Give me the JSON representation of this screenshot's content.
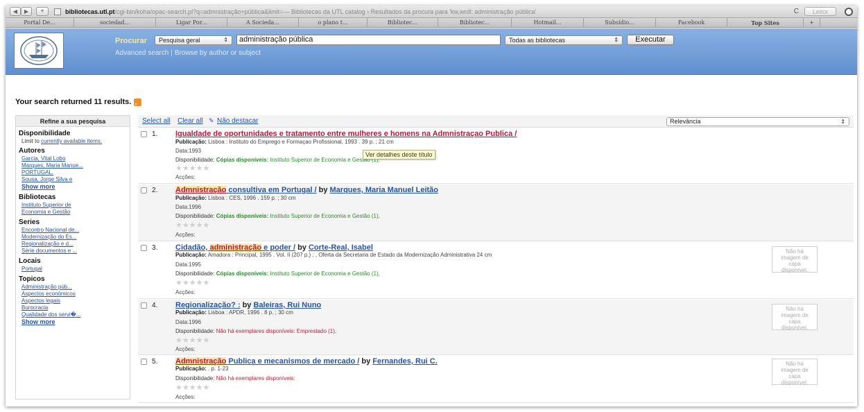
{
  "browser": {
    "url_host": "bibliotecas.utl.pt",
    "url_path": "/cgi-bin/koha/opac-search.pl?q=admnistração+pública&limit=",
    "page_title": " — Bibliotecas da UTL catalog › Resultados da procura para 'kw,wrdl: administração pública'",
    "reader_button": "Leitor",
    "bookmarks": [
      "Portal De...",
      "sociedad...",
      "Ligar Por...",
      "A Socieda...",
      "o plano t...",
      "Bibliotec...",
      "Bibliotec...",
      "Hotmail...",
      "Subsídio...",
      "Facebook",
      "Top Sites"
    ]
  },
  "header": {
    "search_label": "Procurar",
    "search_type": "Pesquisa geral",
    "search_value": "administração pública",
    "library_select": "Todas as bibliotecas",
    "execute_label": "Executar",
    "advanced_link": "Advanced search",
    "browse_link": "Browse by author or subject"
  },
  "results_summary": "Your search returned 11 results.",
  "sidebar": {
    "title": "Refine a sua pesquisa",
    "availability": {
      "heading": "Disponibilidade",
      "text_prefix": "Limit to ",
      "link": "currently available items."
    },
    "autores": {
      "heading": "Autores",
      "items": [
        "Garcia, Vital Lobo",
        "Marques, Maria Manue...",
        "PORTUGAL.",
        "Sousa, Jorge Silva e"
      ],
      "show_more": "Show more"
    },
    "bibliotecas": {
      "heading": "Bibliotecas",
      "items": [
        "Instituto Superior de",
        "Economia e Gestão"
      ]
    },
    "series": {
      "heading": "Series",
      "items": [
        "Encontro Nacional de...",
        "Modernização do Es...",
        "Regionalização e d...",
        "Série documentos e ..."
      ]
    },
    "locais": {
      "heading": "Locais",
      "items": [
        "Portugal"
      ]
    },
    "topicos": {
      "heading": "Topicos",
      "items": [
        "Administração púb...",
        "Aspectos económicos",
        "Aspectos legais",
        "Burocracia",
        "Qualidade dos servi�..."
      ],
      "show_more": "Show more"
    }
  },
  "toolbar": {
    "select_all": "Select all",
    "clear_all": "Clear all",
    "no_highlight": "Não destacar",
    "sort": "Relevância"
  },
  "tooltip": "Ver detalhes deste título",
  "results": [
    {
      "number": "1.",
      "title_main": "Igualdade de oportunidades e tratamento entre mulheres e homens na Admnistraçao Publica /",
      "publication_label": "Publicação:",
      "publication": "Lisboa : Instituto do Emprego e Formaçao Profissional, 1993 . 39 p. ; 21 cm",
      "date": "Data:1993",
      "availability_label": "Disponibilidade:",
      "availability_status": "Cópias disponíveis:",
      "availability_detail": "Instituto Superior de Economia e Gestão (1),",
      "actions": "Acções:"
    },
    {
      "number": "2.",
      "title_hl": "Admnistração",
      "title_main": " consultiva em Portugal /",
      "by": " by ",
      "author": "Marques, Maria Manuel Leitão",
      "publication_label": "Publicação:",
      "publication": "Lisboa : CES, 1996 . 159 p. ; 30 cm",
      "date": "Data:1996",
      "availability_label": "Disponibilidade:",
      "availability_status": "Cópias disponíveis:",
      "availability_detail": "Instituto Superior de Economia e Gestão (1),",
      "actions": "Acções:"
    },
    {
      "number": "3.",
      "title_pre": "Cidadão, ",
      "title_hl": "administração",
      "title_main": " e poder /",
      "by": " by ",
      "author": "Corte-Real, Isabel",
      "publication_label": "Publicação:",
      "publication": "Amadora : Principal, 1995 . Vol. II (207 p.) ; , Oferta da Secretaria de Estado da Modernização Administrativa 24 cm",
      "date": "Data:1995",
      "availability_label": "Disponibilidade:",
      "availability_status": "Cópias disponíveis:",
      "availability_detail": "Instituto Superior de Economia e Gestão (1),",
      "actions": "Acções:",
      "no_image": [
        "Não há",
        "imagem de",
        "capa",
        "disponível."
      ]
    },
    {
      "number": "4.",
      "title_main": "Regionalização? :",
      "by": " by ",
      "author": "Baleiras, Rui Nuno",
      "publication_label": "Publicação:",
      "publication": "Lisboa : APDR, 1996 . 8 p. ; 30 cm",
      "date": "Data:1996",
      "availability_label": "Disponibilidade:",
      "availability_status": "Não há exemplares disponíveis: Emprestado (1),",
      "actions": "Acções:",
      "no_image": [
        "Não há",
        "imagem de",
        "capa",
        "disponível."
      ]
    },
    {
      "number": "5.",
      "title_hl": "Admnistração",
      "title_main": " Publica e mecanismos de mercado /",
      "by": " by ",
      "author": "Fernandes, Rui C.",
      "publication_label": "Publicação:",
      "publication": ". p. 1-23",
      "availability_label": "Disponibilidade:",
      "availability_status": "Não há exemplares disponíveis:",
      "actions": "Acções:",
      "no_image": [
        "Não há",
        "imagem de",
        "capa",
        "disponível."
      ]
    }
  ]
}
